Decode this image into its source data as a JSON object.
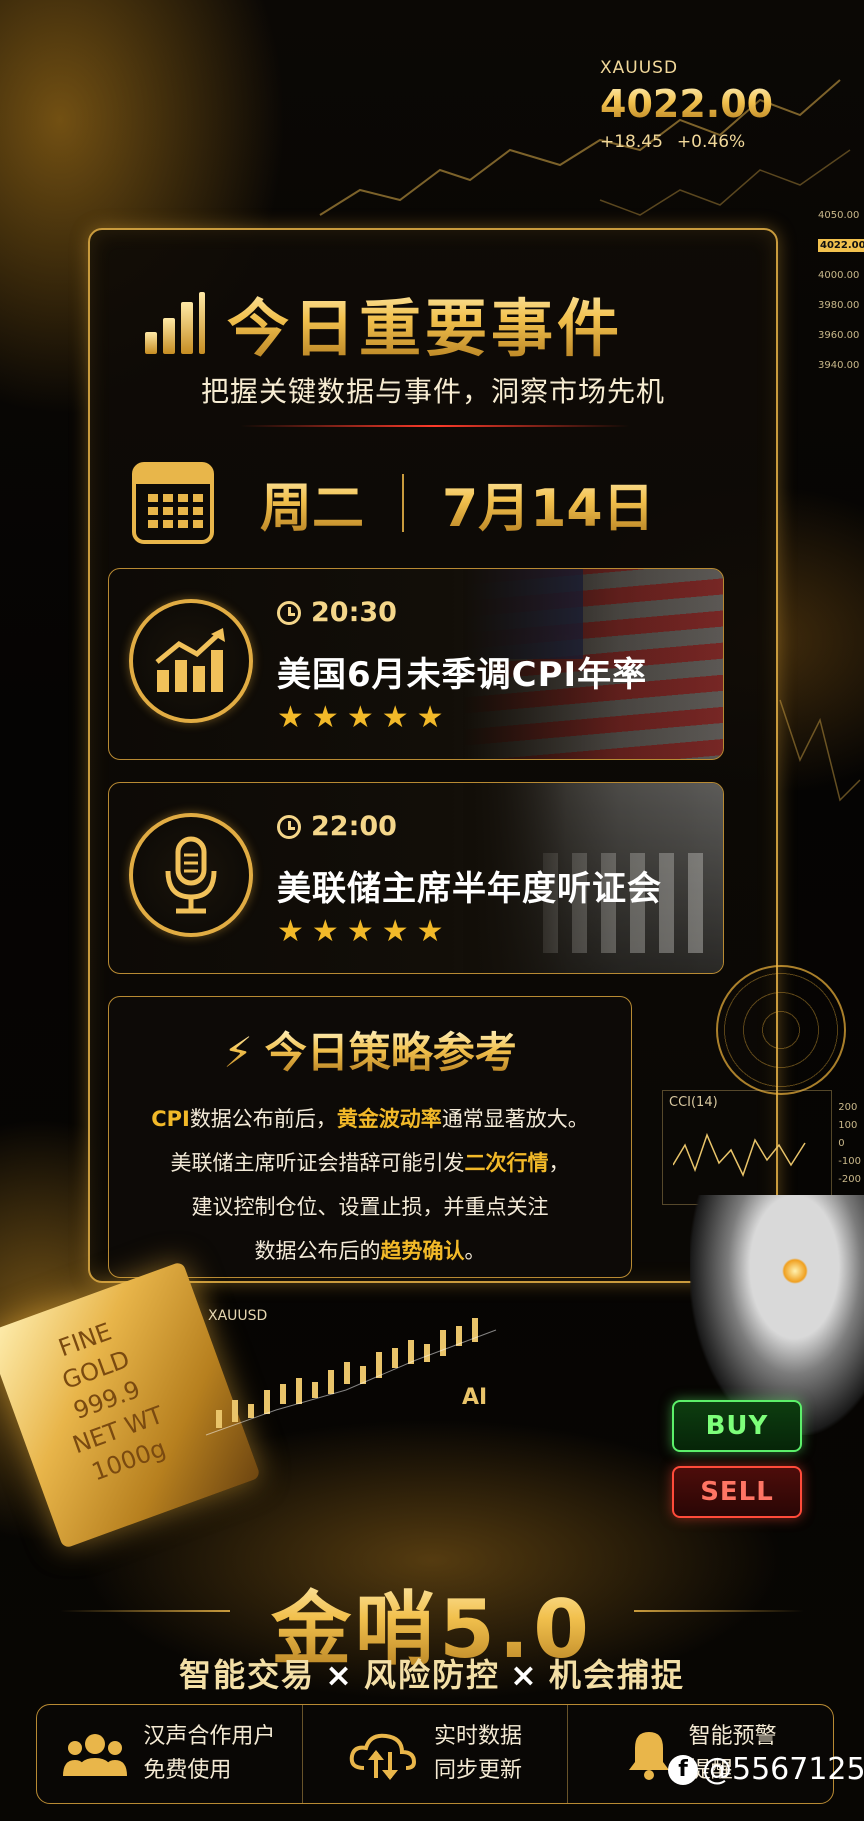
{
  "ticker": {
    "symbol": "XAUUSD",
    "price": "4022.00",
    "change": "+18.45",
    "change_pct": "+0.46%"
  },
  "price_axis": [
    "4050.00",
    "4022.00",
    "4000.00",
    "3980.00",
    "3960.00",
    "3940.00"
  ],
  "header": {
    "title": "今日重要事件",
    "subtitle": "把握关键数据与事件，洞察市场先机"
  },
  "date": {
    "weekday": "周二",
    "date": "7月14日"
  },
  "events": [
    {
      "time": "20:30",
      "title": "美国6月未季调CPI年率",
      "stars": 5,
      "icon": "growth-chart-icon"
    },
    {
      "time": "22:00",
      "title": "美联储主席半年度听证会",
      "stars": 5,
      "icon": "microphone-icon"
    }
  ],
  "strategy": {
    "title": "今日策略参考",
    "line1": {
      "a": "CPI",
      "b": "数据公布前后，",
      "c": "黄金波动率",
      "d": "通常显著放大。"
    },
    "line2": {
      "a": "美联储主席听证会措辞可能引发",
      "b": "二次行情",
      "c": "，"
    },
    "line3": "建议控制仓位、设置止损，并重点关注",
    "line4": {
      "a": "数据公布后的",
      "b": "趋势确认",
      "c": "。"
    }
  },
  "side": {
    "cci_label": "CCI(14)",
    "cci_axis": [
      "200",
      "100",
      "0",
      "-100",
      "-200"
    ],
    "chart_symbol": "XAUUSD",
    "ai_label": "AI",
    "buy": "BUY",
    "sell": "SELL"
  },
  "goldbar": {
    "line1": "FINE",
    "line2": "GOLD",
    "line3": "999.9",
    "line4": "NET WT",
    "line5": "1000g"
  },
  "brand": {
    "name": "金哨5.0",
    "tag1": "智能交易",
    "tag2": "风险防控",
    "tag3": "机会捕捉",
    "sep": "×"
  },
  "features": [
    {
      "icon": "users-icon",
      "line1": "汉声合作用户",
      "line2": "免费使用"
    },
    {
      "icon": "cloud-sync-icon",
      "line1": "实时数据",
      "line2": "同步更新"
    },
    {
      "icon": "bell-icon",
      "line1": "智能预警",
      "line2": "提醒"
    }
  ],
  "watermark": "@5567125",
  "colors": {
    "gold": "#f2b929",
    "buy": "#5cf06a",
    "sell": "#ff4b3a",
    "highlight_line": "#ff3b2a"
  }
}
